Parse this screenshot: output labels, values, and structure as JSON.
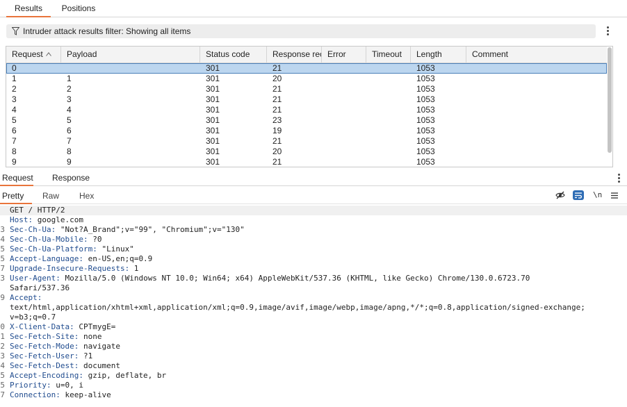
{
  "top_tabs": {
    "results": "Results",
    "positions": "Positions"
  },
  "filter": {
    "text": "Intruder attack results filter: Showing all items"
  },
  "table": {
    "columns": [
      "Request",
      "Payload",
      "Status code",
      "Response rec...",
      "Error",
      "Timeout",
      "Length",
      "Comment"
    ],
    "rows": [
      {
        "request": "0",
        "payload": "",
        "status": "301",
        "received": "21",
        "error": "",
        "timeout": "",
        "length": "1053",
        "comment": ""
      },
      {
        "request": "1",
        "payload": "1",
        "status": "301",
        "received": "20",
        "error": "",
        "timeout": "",
        "length": "1053",
        "comment": ""
      },
      {
        "request": "2",
        "payload": "2",
        "status": "301",
        "received": "21",
        "error": "",
        "timeout": "",
        "length": "1053",
        "comment": ""
      },
      {
        "request": "3",
        "payload": "3",
        "status": "301",
        "received": "21",
        "error": "",
        "timeout": "",
        "length": "1053",
        "comment": ""
      },
      {
        "request": "4",
        "payload": "4",
        "status": "301",
        "received": "21",
        "error": "",
        "timeout": "",
        "length": "1053",
        "comment": ""
      },
      {
        "request": "5",
        "payload": "5",
        "status": "301",
        "received": "23",
        "error": "",
        "timeout": "",
        "length": "1053",
        "comment": ""
      },
      {
        "request": "6",
        "payload": "6",
        "status": "301",
        "received": "19",
        "error": "",
        "timeout": "",
        "length": "1053",
        "comment": ""
      },
      {
        "request": "7",
        "payload": "7",
        "status": "301",
        "received": "21",
        "error": "",
        "timeout": "",
        "length": "1053",
        "comment": ""
      },
      {
        "request": "8",
        "payload": "8",
        "status": "301",
        "received": "20",
        "error": "",
        "timeout": "",
        "length": "1053",
        "comment": ""
      },
      {
        "request": "9",
        "payload": "9",
        "status": "301",
        "received": "21",
        "error": "",
        "timeout": "",
        "length": "1053",
        "comment": ""
      }
    ]
  },
  "rr_tabs": {
    "request": "Request",
    "response": "Response"
  },
  "view_tabs": {
    "pretty": "Pretty",
    "raw": "Raw",
    "hex": "Hex"
  },
  "toolbar_icons": [
    "eye-slash-icon",
    "wrap-text-icon",
    "newline-icon",
    "menu-icon"
  ],
  "newline_label": "\\n",
  "colors": {
    "accent": "#e8743b",
    "selection": "#bcd6ef",
    "header_name": "#1f4b8e"
  },
  "editor": {
    "lines": [
      {
        "num": "",
        "name": "GET / HTTP/2",
        "value": ""
      },
      {
        "num": "",
        "name": "Host:",
        "value": " google.com"
      },
      {
        "num": "3",
        "name": "Sec-Ch-Ua:",
        "value": " \"Not?A_Brand\";v=\"99\", \"Chromium\";v=\"130\""
      },
      {
        "num": "4",
        "name": "Sec-Ch-Ua-Mobile:",
        "value": " ?0"
      },
      {
        "num": "5",
        "name": "Sec-Ch-Ua-Platform:",
        "value": " \"Linux\""
      },
      {
        "num": "5",
        "name": "Accept-Language:",
        "value": " en-US,en;q=0.9"
      },
      {
        "num": "7",
        "name": "Upgrade-Insecure-Requests:",
        "value": " 1"
      },
      {
        "num": "3",
        "name": "User-Agent:",
        "value": " Mozilla/5.0 (Windows NT 10.0; Win64; x64) AppleWebKit/537.36 (KHTML, like Gecko) Chrome/130.0.6723.70"
      },
      {
        "num": "",
        "name": "",
        "value": "Safari/537.36"
      },
      {
        "num": "9",
        "name": "Accept:",
        "value": ""
      },
      {
        "num": "",
        "name": "",
        "value": "text/html,application/xhtml+xml,application/xml;q=0.9,image/avif,image/webp,image/apng,*/*;q=0.8,application/signed-exchange;"
      },
      {
        "num": "",
        "name": "",
        "value": "v=b3;q=0.7"
      },
      {
        "num": "0",
        "name": "X-Client-Data:",
        "value": " CPTmygE="
      },
      {
        "num": "1",
        "name": "Sec-Fetch-Site:",
        "value": " none"
      },
      {
        "num": "2",
        "name": "Sec-Fetch-Mode:",
        "value": " navigate"
      },
      {
        "num": "3",
        "name": "Sec-Fetch-User:",
        "value": " ?1"
      },
      {
        "num": "4",
        "name": "Sec-Fetch-Dest:",
        "value": " document"
      },
      {
        "num": "5",
        "name": "Accept-Encoding:",
        "value": " gzip, deflate, br"
      },
      {
        "num": "5",
        "name": "Priority:",
        "value": " u=0, i"
      },
      {
        "num": "7",
        "name": "Connection:",
        "value": " keep-alive"
      }
    ]
  }
}
